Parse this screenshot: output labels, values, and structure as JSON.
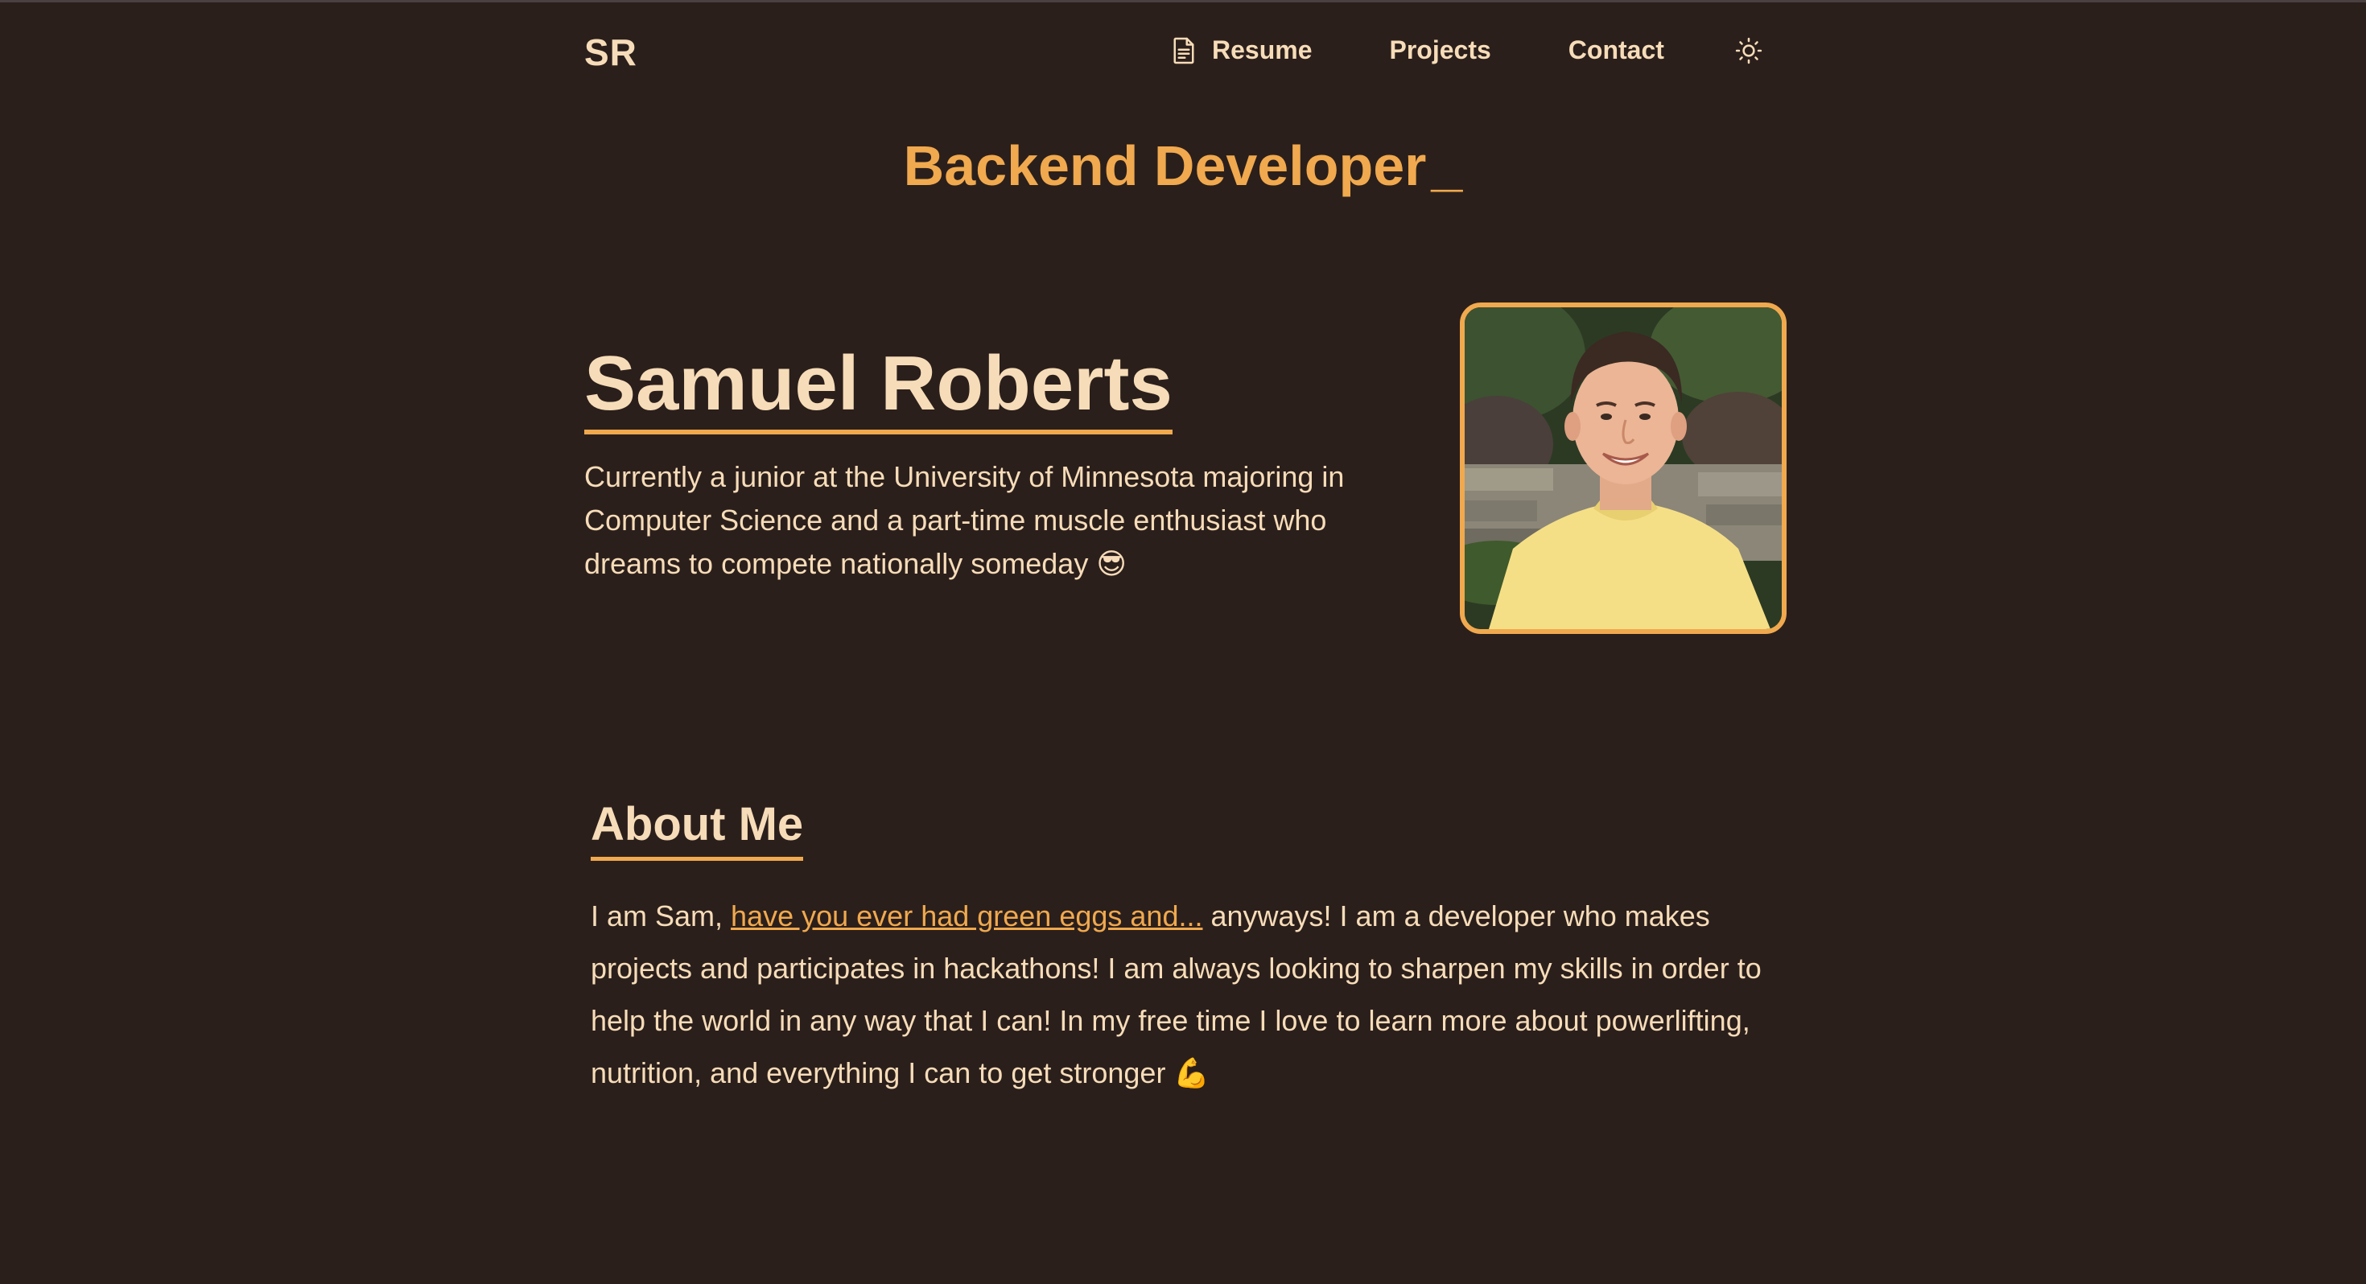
{
  "nav": {
    "logo": "SR",
    "resume_label": "Resume",
    "projects_label": "Projects",
    "contact_label": "Contact",
    "theme_toggle_icon": "sun-icon",
    "resume_icon": "document-icon"
  },
  "hero": {
    "role": "Backend Developer",
    "cursor": "_",
    "name": "Samuel Roberts",
    "bio": "Currently a junior at the University of Minnesota majoring in Computer Science and a part-time muscle enthusiast who dreams to compete nationally someday 😎"
  },
  "about": {
    "title": "About Me",
    "intro": "I am Sam, ",
    "link_text": "have you ever had green eggs and...",
    "rest": " anyways! I am a developer who makes projects and participates in hackathons! I am always looking to sharpen my skills in order to help the world in any way that I can! In my free time I love to learn more about powerlifting, nutrition, and everything I can to get stronger 💪"
  },
  "colors": {
    "background": "#2b1f1c",
    "text": "#f6dcb8",
    "accent": "#f0a94e"
  }
}
